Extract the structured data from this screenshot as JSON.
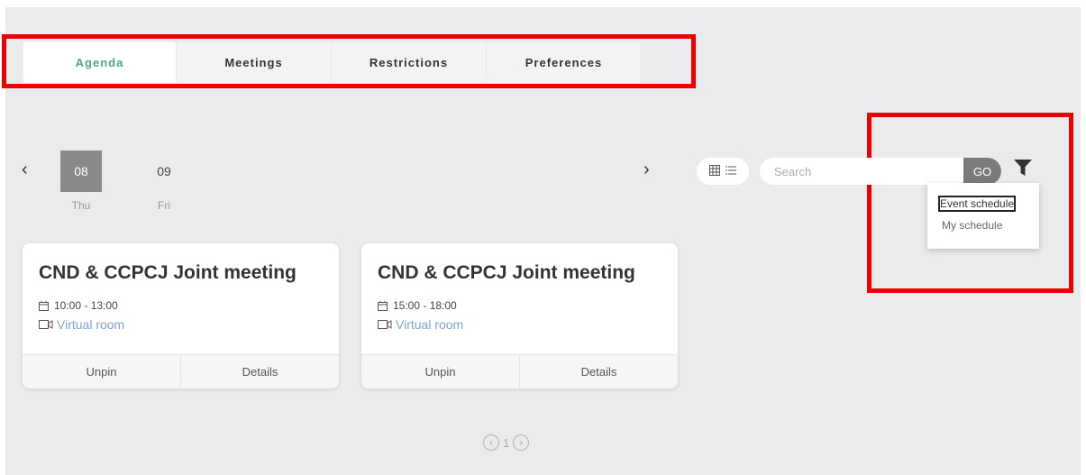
{
  "tabs": [
    {
      "label": "Agenda",
      "active": true
    },
    {
      "label": "Meetings",
      "active": false
    },
    {
      "label": "Restrictions",
      "active": false
    },
    {
      "label": "Preferences",
      "active": false
    }
  ],
  "dates": [
    {
      "num": "08",
      "day": "Thu",
      "active": true
    },
    {
      "num": "09",
      "day": "Fri",
      "active": false
    }
  ],
  "nav": {
    "prev": "‹",
    "next": "›"
  },
  "search": {
    "placeholder": "Search",
    "go_label": "GO"
  },
  "dropdown": {
    "options": [
      "Event schedule",
      "My schedule"
    ],
    "focused": "Event schedule"
  },
  "cards": [
    {
      "title": "CND & CCPCJ Joint meeting",
      "time": "10:00 - 13:00",
      "room": "Virtual room",
      "unpin": "Unpin",
      "details": "Details"
    },
    {
      "title": "CND & CCPCJ Joint meeting",
      "time": "15:00 - 18:00",
      "room": "Virtual room",
      "unpin": "Unpin",
      "details": "Details"
    }
  ],
  "pagination": {
    "current": "1"
  },
  "colors": {
    "accent": "#4ba98a",
    "annotation": "#ee0000",
    "link": "#7ea4cc",
    "go_button": "#7b7b7b"
  }
}
